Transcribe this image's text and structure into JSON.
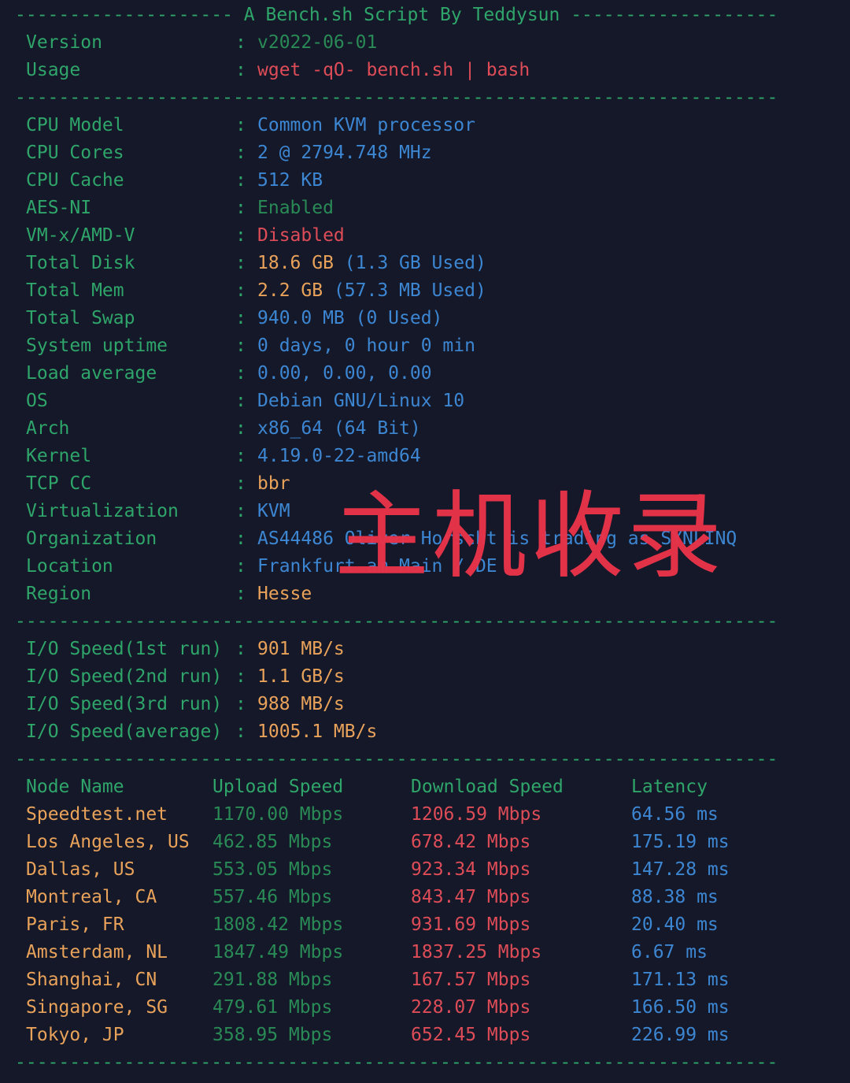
{
  "header": {
    "title_line": "-------------------- A Bench.sh Script By Teddysun -------------------",
    "rows": [
      {
        "label": "Version",
        "value": "v2022-06-01",
        "color": "dgreen"
      },
      {
        "label": "Usage",
        "value": "wget -qO- bench.sh | bash",
        "color": "red"
      }
    ]
  },
  "separator": "----------------------------------------------------------------------",
  "system": [
    {
      "label": "CPU Model",
      "value": "Common KVM processor",
      "color": "blue"
    },
    {
      "label": "CPU Cores",
      "value": "2 @ 2794.748 MHz",
      "color": "blue"
    },
    {
      "label": "CPU Cache",
      "value": "512 KB",
      "color": "blue"
    },
    {
      "label": "AES-NI",
      "value": "Enabled",
      "color": "dgreen"
    },
    {
      "label": "VM-x/AMD-V",
      "value": "Disabled",
      "color": "red"
    },
    {
      "label": "Total Disk",
      "value": "18.6 GB",
      "extra": " (1.3 GB Used)",
      "color": "orange"
    },
    {
      "label": "Total Mem",
      "value": "2.2 GB",
      "extra": " (57.3 MB Used)",
      "color": "orange"
    },
    {
      "label": "Total Swap",
      "value": "940.0 MB (0 Used)",
      "color": "blue"
    },
    {
      "label": "System uptime",
      "value": "0 days, 0 hour 0 min",
      "color": "blue"
    },
    {
      "label": "Load average",
      "value": "0.00, 0.00, 0.00",
      "color": "blue"
    },
    {
      "label": "OS",
      "value": "Debian GNU/Linux 10",
      "color": "blue"
    },
    {
      "label": "Arch",
      "value": "x86_64 (64 Bit)",
      "color": "blue"
    },
    {
      "label": "Kernel",
      "value": "4.19.0-22-amd64",
      "color": "blue"
    },
    {
      "label": "TCP CC",
      "value": "bbr",
      "color": "orange"
    },
    {
      "label": "Virtualization",
      "value": "KVM",
      "color": "blue"
    },
    {
      "label": "Organization",
      "value": "AS44486 Oliver Horscht is trading as SYNLINQ",
      "color": "blue"
    },
    {
      "label": "Location",
      "value": "Frankfurt am Main / DE",
      "color": "blue"
    },
    {
      "label": "Region",
      "value": "Hesse",
      "color": "orange"
    }
  ],
  "io": [
    {
      "label": "I/O Speed(1st run)",
      "value": "901 MB/s"
    },
    {
      "label": "I/O Speed(2nd run)",
      "value": "1.1 GB/s"
    },
    {
      "label": "I/O Speed(3rd run)",
      "value": "988 MB/s"
    },
    {
      "label": "I/O Speed(average)",
      "value": "1005.1 MB/s"
    }
  ],
  "speedtest": {
    "headers": [
      "Node Name",
      "Upload Speed",
      "Download Speed",
      "Latency"
    ],
    "rows": [
      {
        "node": "Speedtest.net",
        "upload": "1170.00 Mbps",
        "download": "1206.59 Mbps",
        "latency": "64.56 ms"
      },
      {
        "node": "Los Angeles, US",
        "upload": "462.85 Mbps",
        "download": "678.42 Mbps",
        "latency": "175.19 ms"
      },
      {
        "node": "Dallas, US",
        "upload": "553.05 Mbps",
        "download": "923.34 Mbps",
        "latency": "147.28 ms"
      },
      {
        "node": "Montreal, CA",
        "upload": "557.46 Mbps",
        "download": "843.47 Mbps",
        "latency": "88.38 ms"
      },
      {
        "node": "Paris, FR",
        "upload": "1808.42 Mbps",
        "download": "931.69 Mbps",
        "latency": "20.40 ms"
      },
      {
        "node": "Amsterdam, NL",
        "upload": "1847.49 Mbps",
        "download": "1837.25 Mbps",
        "latency": "6.67 ms"
      },
      {
        "node": "Shanghai, CN",
        "upload": "291.88 Mbps",
        "download": "167.57 Mbps",
        "latency": "171.13 ms"
      },
      {
        "node": "Singapore, SG",
        "upload": "479.61 Mbps",
        "download": "228.07 Mbps",
        "latency": "166.50 ms"
      },
      {
        "node": "Tokyo, JP",
        "upload": "358.95 Mbps",
        "download": "652.45 Mbps",
        "latency": "226.99 ms"
      }
    ]
  },
  "watermark": "主机收录",
  "colors": {
    "background": "#141829",
    "green": "#2fa56a",
    "blue": "#3d86d2",
    "orange": "#e9a25a",
    "red": "#dd4c57",
    "watermark": "#e8334a"
  }
}
